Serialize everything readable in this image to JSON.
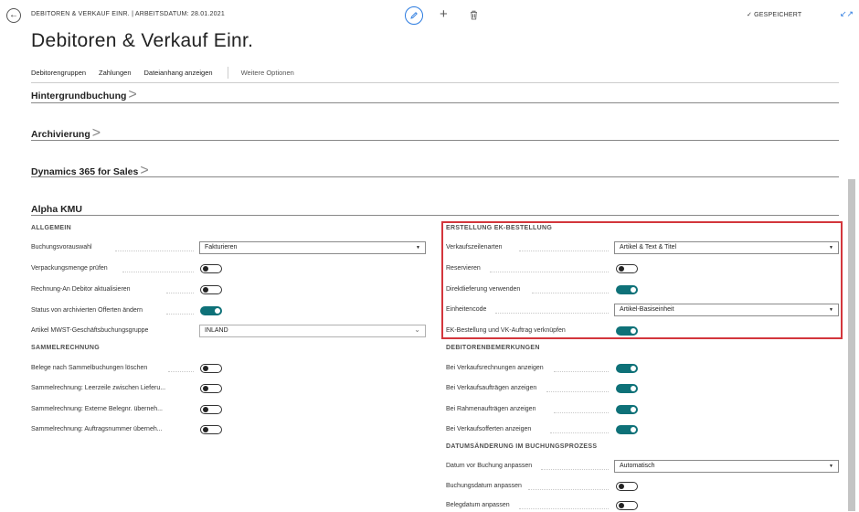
{
  "header": {
    "breadcrumb": "DEBITOREN & VERKAUF EINR. | ARBEITSDATUM: 28.01.2021",
    "saved_label": "GESPEICHERT",
    "icons": [
      "back-arrow-icon",
      "edit-pencil-icon",
      "plus-icon",
      "trash-icon",
      "check-icon",
      "collapse-icon"
    ]
  },
  "page": {
    "title": "Debitoren & Verkauf Einr."
  },
  "actions": {
    "items": [
      "Debitorengruppen",
      "Zahlungen",
      "Dateianhang anzeigen"
    ],
    "more": "Weitere Optionen"
  },
  "fasttabs": {
    "hintergrund": "Hintergrundbuchung",
    "archivierung": "Archivierung",
    "dynamics": "Dynamics 365 for Sales",
    "alpha": "Alpha KMU",
    "chevron": ">"
  },
  "left": {
    "allgemein": {
      "title": "ALLGEMEIN",
      "buchungsvorauswahl": {
        "label": "Buchungsvorauswahl",
        "value": "Fakturieren"
      },
      "verpackungsmenge": {
        "label": "Verpackungsmenge prüfen",
        "on": false
      },
      "rechnung_an": {
        "label": "Rechnung-An Debitor aktualisieren",
        "on": false
      },
      "status_offerten": {
        "label": "Status von archivierten Offerten ändern",
        "on": true
      },
      "mwst": {
        "label": "Artikel MWST-Geschäftsbuchungsgruppe",
        "value": "INLAND"
      }
    },
    "sammelrechnung": {
      "title": "SAMMELRECHNUNG",
      "belege_loeschen": {
        "label": "Belege nach Sammelbuchungen löschen",
        "on": false
      },
      "leerzeile": {
        "label": "Sammelrechnung: Leerzeile zwischen Lieferu...",
        "on": false
      },
      "externe_belegnr": {
        "label": "Sammelrechnung: Externe Belegnr. überneh...",
        "on": false
      },
      "auftragsnummer": {
        "label": "Sammelrechnung: Auftragsnummer überneh...",
        "on": false
      }
    }
  },
  "right": {
    "ek_bestellung": {
      "title": "ERSTELLUNG EK-BESTELLUNG",
      "verkaufszeilenarten": {
        "label": "Verkaufszeilenarten",
        "value": "Artikel & Text & Titel"
      },
      "reservieren": {
        "label": "Reservieren",
        "on": false
      },
      "direktlieferung": {
        "label": "Direktlieferung verwenden",
        "on": true
      },
      "einheitencode": {
        "label": "Einheitencode",
        "value": "Artikel-Basiseinheit"
      },
      "ek_vk_verknuepfen": {
        "label": "EK-Bestellung und VK-Auftrag verknüpfen",
        "on": true
      }
    },
    "debitorenbemerkungen": {
      "title": "DEBITORENBEMERKUNGEN",
      "verkaufsrechnungen": {
        "label": "Bei Verkaufsrechnungen anzeigen",
        "on": true
      },
      "verkaufsauftraegen": {
        "label": "Bei Verkaufsaufträgen anzeigen",
        "on": true
      },
      "rahmenauftraegen": {
        "label": "Bei Rahmenaufträgen anzeigen",
        "on": true
      },
      "verkaufsofferten": {
        "label": "Bei Verkaufsofferten anzeigen",
        "on": true
      }
    },
    "datumsaenderung": {
      "title": "DATUMSÄNDERUNG IM BUCHUNGSPROZESS",
      "datum_vor_buchung": {
        "label": "Datum vor Buchung anpassen",
        "value": "Automatisch"
      },
      "buchungsdatum": {
        "label": "Buchungsdatum anpassen",
        "on": false
      },
      "belegdatum": {
        "label": "Belegdatum anpassen",
        "on": false
      }
    }
  },
  "colors": {
    "accent": "#2b7be0",
    "toggle_on": "#0e7178",
    "highlight": "#d3363c"
  }
}
